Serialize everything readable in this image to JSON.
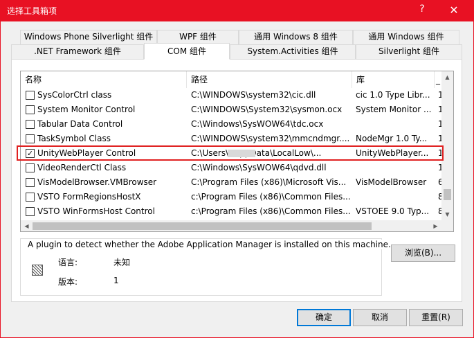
{
  "window": {
    "title": "选择工具箱项",
    "help_label": "?",
    "close_label": "✕"
  },
  "tabs": {
    "row1": [
      {
        "label": "Windows Phone Silverlight 组件"
      },
      {
        "label": "WPF 组件"
      },
      {
        "label": "通用 Windows 8 组件"
      },
      {
        "label": "通用 Windows 组件"
      }
    ],
    "row2": [
      {
        "label": ".NET Framework 组件"
      },
      {
        "label": "COM 组件",
        "active": true
      },
      {
        "label": "System.Activities 组件"
      },
      {
        "label": "Silverlight 组件"
      }
    ]
  },
  "list": {
    "columns": [
      "名称",
      "路径",
      "库",
      "_"
    ],
    "rows": [
      {
        "checked": false,
        "name": "SysColorCtrl class",
        "path": "C:\\WINDOWS\\system32\\cic.dll",
        "library": "cic 1.0 Type Libr...",
        "extra": "1"
      },
      {
        "checked": false,
        "name": "System Monitor Control",
        "path": "C:\\WINDOWS\\System32\\sysmon.ocx",
        "library": "System Monitor ...",
        "extra": "1"
      },
      {
        "checked": false,
        "name": "Tabular Data Control",
        "path": "C:\\Windows\\SysWOW64\\tdc.ocx",
        "library": "",
        "extra": "1"
      },
      {
        "checked": false,
        "name": "TaskSymbol Class",
        "path": "C:\\WINDOWS\\system32\\mmcndmgr....",
        "library": "NodeMgr 1.0 Ty...",
        "extra": "1"
      },
      {
        "checked": true,
        "name": "UnityWebPlayer Control",
        "path": "C:\\Users\\        \\AppData\\LocalLow\\...",
        "library": "UnityWebPlayer...",
        "extra": "1"
      },
      {
        "checked": false,
        "name": "VideoRenderCtl Class",
        "path": "C:\\Windows\\SysWOW64\\qdvd.dll",
        "library": "",
        "extra": "1"
      },
      {
        "checked": false,
        "name": "VisModelBrowser.VMBrowser",
        "path": "C:\\Program Files (x86)\\Microsoft Vis...",
        "library": "VisModelBrowser",
        "extra": "6"
      },
      {
        "checked": false,
        "name": "VSTO FormRegionsHostX",
        "path": "c:\\Program Files (x86)\\Common Files...",
        "library": "",
        "extra": "8"
      },
      {
        "checked": false,
        "name": "VSTO WinFormsHost Control",
        "path": "c:\\Program Files (x86)\\Common Files...",
        "library": "VSTOEE 9.0 Typ...",
        "extra": "8"
      }
    ],
    "scroll_up": "▲",
    "scroll_down": "▼",
    "scroll_left": "◀",
    "scroll_right": "▶"
  },
  "details": {
    "description": "A plugin to detect whether the Adobe Application Manager is installed on this machine.",
    "language_label": "语言:",
    "language_value": "未知",
    "version_label": "版本:",
    "version_value": "1"
  },
  "buttons": {
    "browse": "浏览(B)...",
    "ok": "确定",
    "cancel": "取消",
    "reset": "重置(R)"
  }
}
